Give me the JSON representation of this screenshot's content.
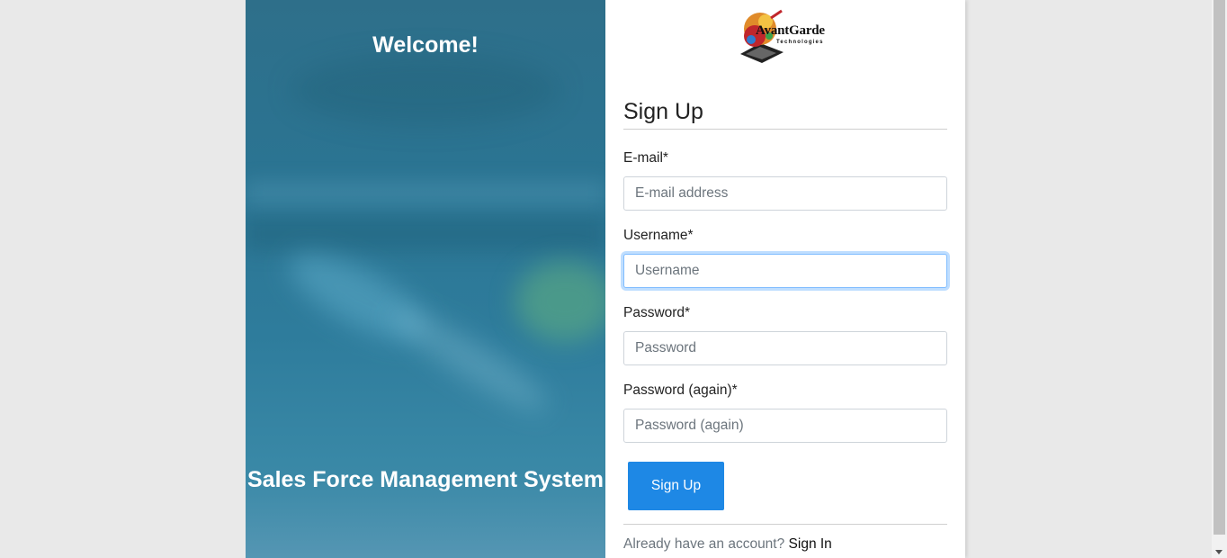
{
  "left_panel": {
    "welcome": "Welcome!",
    "system_title": "Sales Force Management System"
  },
  "logo": {
    "name": "AvantGarde",
    "sub": "Technologies"
  },
  "form": {
    "title": "Sign Up",
    "fields": [
      {
        "label": "E-mail*",
        "placeholder": "E-mail address",
        "value": ""
      },
      {
        "label": "Username*",
        "placeholder": "Username",
        "value": ""
      },
      {
        "label": "Password*",
        "placeholder": "Password",
        "value": ""
      },
      {
        "label": "Password (again)*",
        "placeholder": "Password (again)",
        "value": ""
      }
    ],
    "submit_label": "Sign Up",
    "footer_prompt": "Already have an account?",
    "footer_link": "Sign In"
  },
  "colors": {
    "accent": "#1e88e5",
    "panel": "#2b7492",
    "focus": "#80bdff"
  }
}
